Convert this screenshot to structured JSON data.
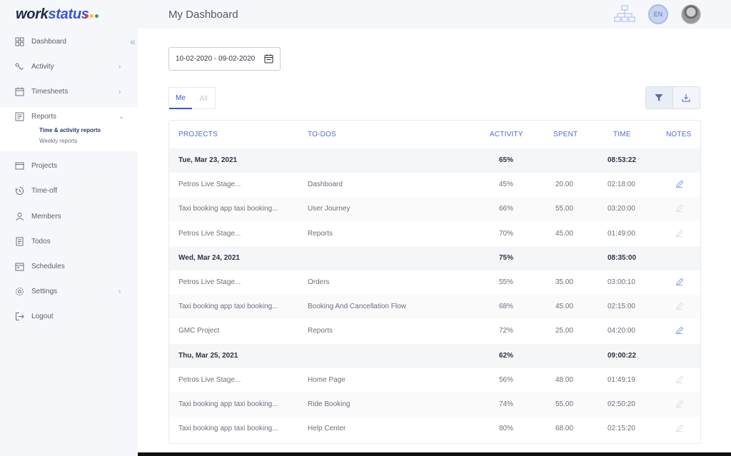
{
  "app": {
    "logo_work": "work",
    "logo_status": "status",
    "logo_dot_colors": [
      "#e53935",
      "#fbc02d",
      "#43a047"
    ],
    "accent": "#3a55d4"
  },
  "header": {
    "title": "My Dashboard",
    "org_icon": "org-chart-icon",
    "language": "EN",
    "avatar": "user-avatar"
  },
  "sidebar": {
    "collapse_glyph": "«",
    "items": [
      {
        "label": "Dashboard",
        "icon": "dashboard-icon"
      },
      {
        "label": "Activity",
        "icon": "activity-icon",
        "chevron": "›"
      },
      {
        "label": "Timesheets",
        "icon": "timesheets-icon",
        "chevron": "›"
      },
      {
        "label": "Reports",
        "icon": "reports-icon",
        "chevron": "⌄"
      },
      {
        "label": "Projects",
        "icon": "projects-icon"
      },
      {
        "label": "Time-off",
        "icon": "time-off-icon"
      },
      {
        "label": "Members",
        "icon": "members-icon"
      },
      {
        "label": "Todos",
        "icon": "todos-icon"
      },
      {
        "label": "Schedules",
        "icon": "schedules-icon"
      },
      {
        "label": "Settings",
        "icon": "settings-icon",
        "chevron": "›"
      },
      {
        "label": "Logout",
        "icon": "logout-icon"
      }
    ],
    "reports_sub": [
      {
        "label": "Time & activity reports",
        "active": true
      },
      {
        "label": "Weekly reports",
        "active": false
      }
    ]
  },
  "filters": {
    "date_range": "10-02-2020 - 09-02-2020",
    "tabs": [
      {
        "label": "Me",
        "active": true
      },
      {
        "label": "All",
        "active": false
      }
    ],
    "filter_icon": "filter-icon",
    "download_icon": "download-icon"
  },
  "table": {
    "headers": {
      "projects": "PROJECTS",
      "todos": "TO-DOS",
      "activity": "ACTIVITY",
      "spent": "SPENT",
      "time": "TIME",
      "notes": "NOTES"
    },
    "rows": [
      {
        "group": true,
        "project": "Tue, Mar 23, 2021",
        "todo": "",
        "activity": "65%",
        "spent": "",
        "time": "08:53:22"
      },
      {
        "group": false,
        "project": "Petros Live Stage...",
        "todo": "Dashboard",
        "activity": "45%",
        "spent": "20.00",
        "time": "02:18:00",
        "note_active": true
      },
      {
        "group": false,
        "project": "Taxi booking app taxi booking...",
        "todo": "User Journey",
        "activity": "66%",
        "spent": "55.00",
        "time": "03:20:00",
        "note_active": false
      },
      {
        "group": false,
        "project": "Petros Live Stage...",
        "todo": "Reports",
        "activity": "70%",
        "spent": "45.00",
        "time": "01:49:00",
        "note_active": false
      },
      {
        "group": true,
        "project": "Wed, Mar 24, 2021",
        "todo": "",
        "activity": "75%",
        "spent": "",
        "time": "08:35:00"
      },
      {
        "group": false,
        "project": "Petros Live Stage...",
        "todo": "Orders",
        "activity": "55%",
        "spent": "35.00",
        "time": "03:00:10",
        "note_active": true
      },
      {
        "group": false,
        "project": "Taxi booking app taxi booking...",
        "todo": "Booking And Cancellation Flow",
        "activity": "68%",
        "spent": "45.00",
        "time": "02:15:00",
        "note_active": false
      },
      {
        "group": false,
        "project": "GMC Project",
        "todo": "Reports",
        "activity": "72%",
        "spent": "25.00",
        "time": "04:20:00",
        "note_active": true
      },
      {
        "group": true,
        "project": "Thu, Mar 25, 2021",
        "todo": "",
        "activity": "62%",
        "spent": "",
        "time": "09:00:22"
      },
      {
        "group": false,
        "project": "Petros Live Stage...",
        "todo": "Home Page",
        "activity": "56%",
        "spent": "48.00",
        "time": "01:49:19",
        "note_active": false
      },
      {
        "group": false,
        "project": "Taxi booking app taxi booking...",
        "todo": "Ride Booking",
        "activity": "74%",
        "spent": "55.00",
        "time": "02:50:20",
        "note_active": false
      },
      {
        "group": false,
        "project": "Taxi booking app taxi booking...",
        "todo": "Help Center",
        "activity": "80%",
        "spent": "68.00",
        "time": "02:15:20",
        "note_active": false
      }
    ]
  }
}
